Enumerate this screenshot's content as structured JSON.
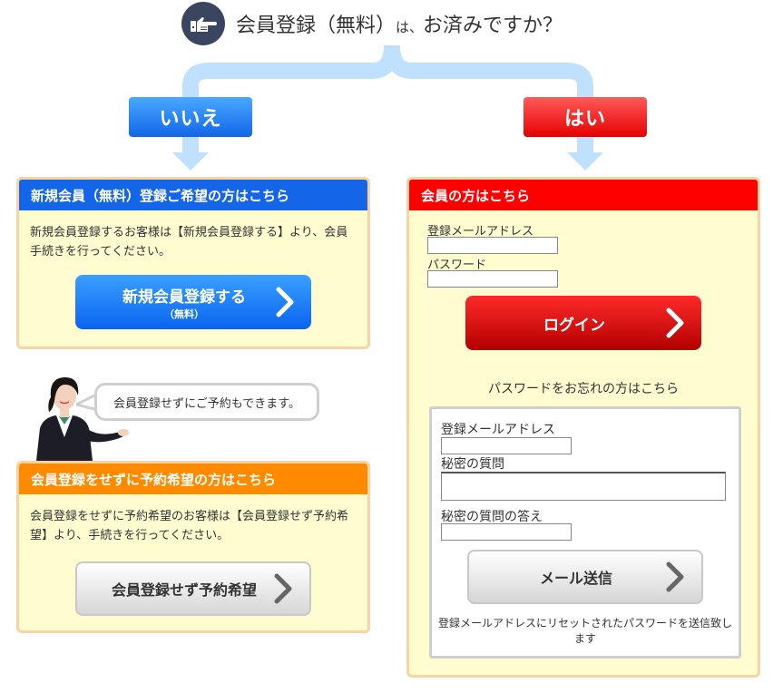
{
  "header": {
    "question_main": "会員登録（無料）",
    "question_particle": "は、",
    "question_end": "お済みですか？",
    "hand_icon": "pointing-hand-icon"
  },
  "choices": {
    "no_label": "いいえ",
    "yes_label": "はい"
  },
  "new_member": {
    "title": "新規会員（無料）登録ご希望の方はこちら",
    "description": "新規会員登録するお客様は【新規会員登録する】より、会員手続きを行ってください。",
    "button_label": "新規会員登録する",
    "button_sub": "（無料）"
  },
  "guest": {
    "bubble_text": "会員登録せずにご予約もできます。",
    "title": "会員登録をせずに予約希望の方はこちら",
    "description": "会員登録をせずに予約希望のお客様は【会員登録せず予約希望】より、手続きを行ってください。",
    "button_label": "会員登録せず予約希望"
  },
  "member": {
    "title": "会員の方はこちら",
    "email_label": "登録メールアドレス",
    "email_value": "",
    "password_label": "パスワード",
    "password_value": "",
    "login_label": "ログイン",
    "forgot_text": "パスワードをお忘れの方はこちら"
  },
  "reset": {
    "email_label": "登録メールアドレス",
    "email_value": "",
    "secret_question_label": "秘密の質問",
    "secret_question_value": "",
    "secret_answer_label": "秘密の質問の答え",
    "secret_answer_value": "",
    "send_label": "メール送信",
    "note": "登録メールアドレスにリセットされたパスワードを送信致します"
  },
  "colors": {
    "blue": "#1565e8",
    "red": "#ff0000",
    "orange": "#ff8a00",
    "panel_bg": "#fffcd0",
    "panel_border": "#f9d3a3",
    "connector": "#bfe0ff"
  }
}
